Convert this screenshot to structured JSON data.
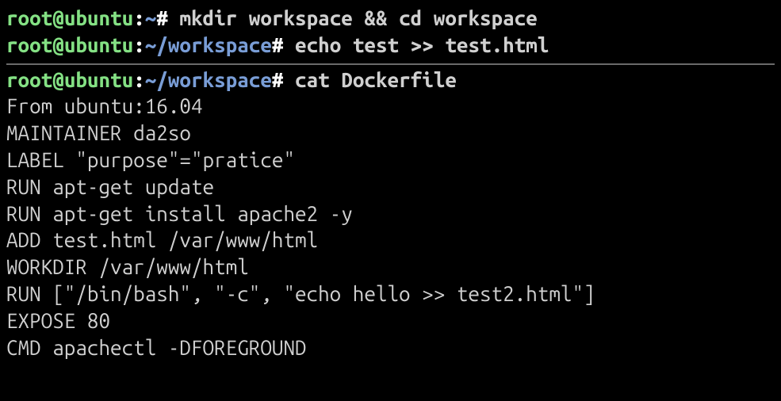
{
  "prompts": {
    "user": "root",
    "at": "@",
    "host": "ubuntu",
    "colon": ":",
    "path_home": "~",
    "path_ws": "~/workspace",
    "symbol": "#"
  },
  "commands": {
    "mkdir": "mkdir workspace && cd workspace",
    "echo": "echo test >> test.html",
    "cat": "cat Dockerfile"
  },
  "dockerfile": {
    "l1": "From ubuntu:16.04",
    "l2": "MAINTAINER da2so",
    "l3": "LABEL \"purpose\"=\"pratice\"",
    "l4": "RUN apt-get update",
    "l5": "RUN apt-get install apache2 -y",
    "l6": "ADD test.html /var/www/html",
    "l7": "WORKDIR /var/www/html",
    "l8": "RUN [\"/bin/bash\", \"-c\", \"echo hello >> test2.html\"]",
    "l9": "EXPOSE 80",
    "l10": "CMD apachectl -DFOREGROUND"
  }
}
